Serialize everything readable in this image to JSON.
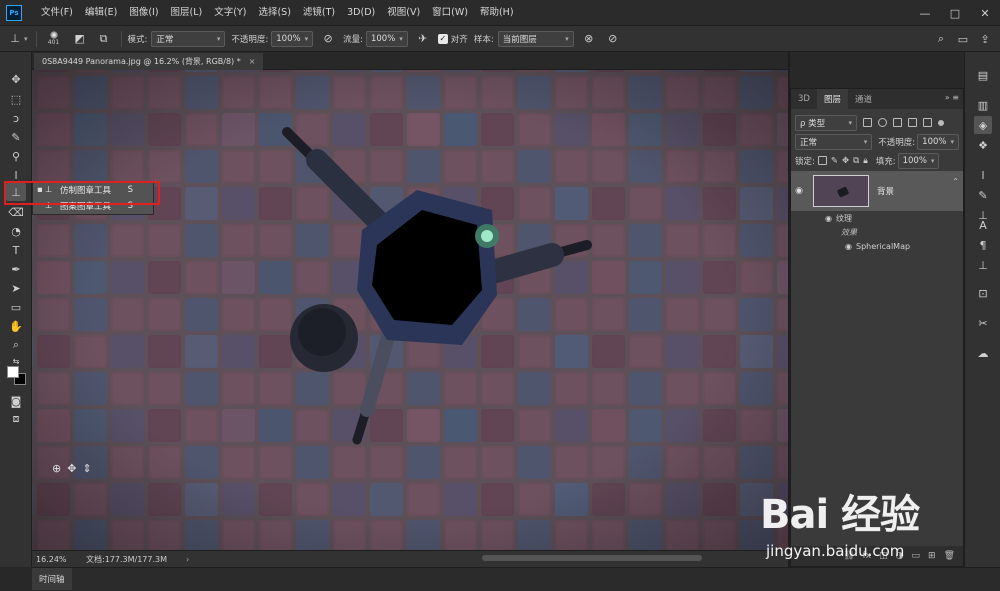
{
  "app": {
    "logo_text": "Ps"
  },
  "menu": [
    "文件(F)",
    "编辑(E)",
    "图像(I)",
    "图层(L)",
    "文字(Y)",
    "选择(S)",
    "滤镜(T)",
    "3D(D)",
    "视图(V)",
    "窗口(W)",
    "帮助(H)"
  ],
  "window_controls": {
    "minimize": "—",
    "maximize": "□",
    "close": "✕"
  },
  "options": {
    "brush_size": "401",
    "mode_label": "模式:",
    "mode_value": "正常",
    "opacity_label": "不透明度:",
    "opacity_value": "100%",
    "flow_label": "流量:",
    "flow_value": "100%",
    "aligned_label": "对齐",
    "sample_label": "样本:",
    "sample_value": "当前图层"
  },
  "document": {
    "tab_title": "0S8A9449 Panorama.jpg @ 16.2% (背景, RGB/8) *",
    "close": "×"
  },
  "flyout": {
    "items": [
      {
        "label": "仿制图章工具",
        "key": "S"
      },
      {
        "label": "图案图章工具",
        "key": "S"
      }
    ]
  },
  "status": {
    "zoom": "16.24%",
    "doc_info": "文档:177.3M/177.3M",
    "caret": "›"
  },
  "timeline": {
    "label": "时间轴"
  },
  "panel": {
    "tabs": [
      "3D",
      "图层",
      "通道"
    ],
    "active_tab": 1,
    "filter_label": "ρ 类型",
    "blend_mode": "正常",
    "opacity_label": "不透明度:",
    "opacity_value": "100%",
    "lock_label": "锁定:",
    "fill_label": "填充:",
    "fill_value": "100%",
    "layer_name": "背景",
    "sub_texture": "纹理",
    "sub_effect_icon": "效果",
    "sub_spherical": "SphericalMap"
  },
  "watermark": {
    "logo": "Bai 经验",
    "url": "jingyan.baidu.com"
  }
}
